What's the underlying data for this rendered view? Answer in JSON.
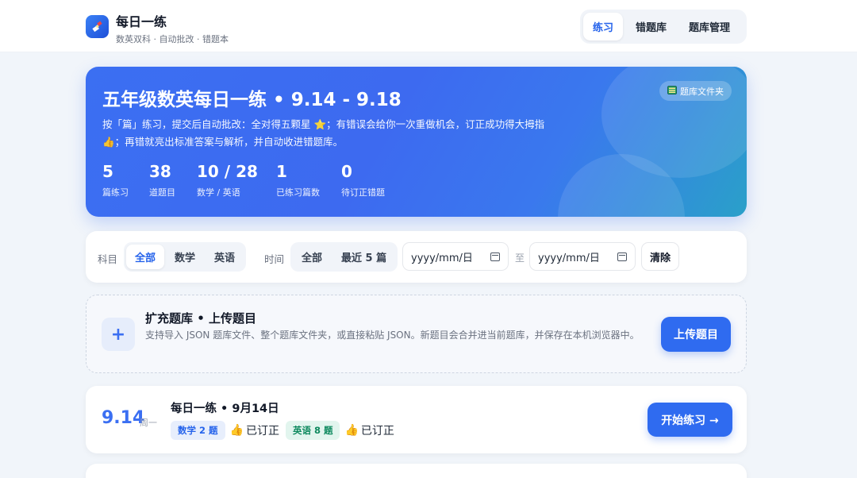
{
  "brand": {
    "title": "每日一练",
    "subtitle": "数英双科 · 自动批改 · 错题本"
  },
  "nav": {
    "items": [
      {
        "label": "练习",
        "active": true
      },
      {
        "label": "错题库",
        "active": false
      },
      {
        "label": "题库管理",
        "active": false
      }
    ]
  },
  "hero": {
    "title": "五年级数英每日一练 • 9.14 - 9.18",
    "desc_part1": "按「篇」练习，提交后自动批改：全对得五颗星 ",
    "desc_star": "⭐",
    "desc_part2": "；有错误会给你一次重做机会，订正成功得大拇指 ",
    "desc_thumb": "👍",
    "desc_part3": "；再错就亮出标准答案与解析，并自动收进错题库。",
    "folder_label": "题库文件夹",
    "stats": [
      {
        "value": "5",
        "label": "篇练习"
      },
      {
        "value": "38",
        "label": "道题目"
      },
      {
        "value": "10 / 28",
        "label": "数学 / 英语"
      },
      {
        "value": "1",
        "label": "已练习篇数"
      },
      {
        "value": "0",
        "label": "待订正错题"
      }
    ]
  },
  "filter": {
    "subject_label": "科目",
    "subjects": [
      {
        "label": "全部",
        "active": true
      },
      {
        "label": "数学",
        "active": false
      },
      {
        "label": "英语",
        "active": false
      }
    ],
    "time_label": "时间",
    "times": [
      {
        "label": "全部",
        "active": false
      },
      {
        "label": "最近 5 篇",
        "active": false
      }
    ],
    "date_from_placeholder": "yyyy/mm/日",
    "to_label": "至",
    "date_to_placeholder": "yyyy/mm/日",
    "clear_label": "清除"
  },
  "upload": {
    "title": "扩充题库 • 上传题目",
    "desc": "支持导入 JSON 题库文件、整个题库文件夹，或直接粘贴 JSON。新题目会合并进当前题库，并保存在本机浏览器中。",
    "button_label": "上传题目"
  },
  "days": [
    {
      "date": "9.14",
      "weekday": "周一",
      "title": "每日一练 • 9月14日",
      "math_tag": "数学 2 题",
      "math_status": "已订正",
      "eng_tag": "英语 8 题",
      "eng_status": "已订正",
      "thumb": "👍",
      "start_label": "开始练习 →"
    }
  ],
  "colors": {
    "accent": "#2f6bf0",
    "hero_start": "#3b6ff2",
    "hero_end": "#2aa0c9",
    "math_tag": "#2563eb",
    "eng_tag": "#0f8a5f"
  }
}
